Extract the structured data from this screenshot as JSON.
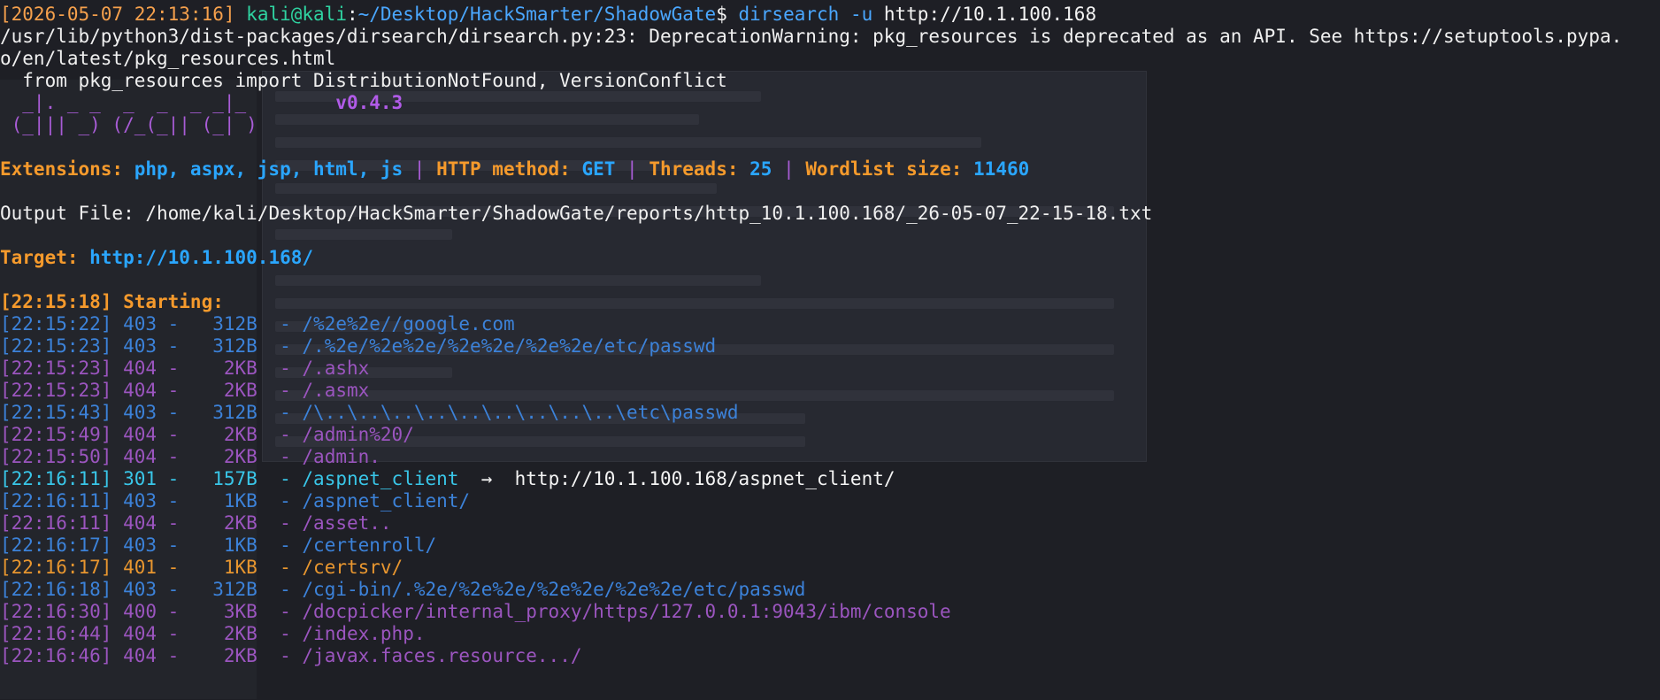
{
  "window": {
    "title": "kali@kali: ~/Desktop/HackSmarter/ShadowGate"
  },
  "prompt": {
    "time": "[2026-05-07 22:13:16]",
    "user_host": "kali@kali",
    "sep": ":",
    "path": "~/Desktop/HackSmarter/ShadowGate",
    "dollar": "$ ",
    "exe": "dirsearch",
    "flag": " -u",
    "arg": " http://10.1.100.168"
  },
  "warning": {
    "line1": "/usr/lib/python3/dist-packages/dirsearch/dirsearch.py:23: DeprecationWarning: pkg_resources is deprecated as an API. See https://setuptools.pypa.",
    "line2": "o/en/latest/pkg_resources.html",
    "line3": "  from pkg_resources import DistributionNotFound, VersionConflict"
  },
  "banner": {
    "top": "  _|. _ _  _  _  _ _|_",
    "bottom": " (_||| _) (/_(_|| (_| )",
    "version": "v0.4.3"
  },
  "config": {
    "ext_label": "Extensions: ",
    "ext_value": "php, aspx, jsp, html, js",
    "sep": " | ",
    "method_label": "HTTP method: ",
    "method_value": "GET",
    "threads_label": "Threads: ",
    "threads_value": "25",
    "wordlist_label": "Wordlist size: ",
    "wordlist_value": "11460"
  },
  "output": {
    "label": "Output File: ",
    "path": "/home/kali/Desktop/HackSmarter/ShadowGate/reports/http_10.1.100.168/_26-05-07_22-15-18.txt"
  },
  "target": {
    "label": "Target: ",
    "url": "http://10.1.100.168/"
  },
  "starting": "[22:15:18] Starting: ",
  "results": [
    {
      "time": "[22:15:22]",
      "code": "403",
      "size": "  312B",
      "path": "/%2e%2e//google.com",
      "redirect": ""
    },
    {
      "time": "[22:15:23]",
      "code": "403",
      "size": "  312B",
      "path": "/.%2e/%2e%2e/%2e%2e/%2e%2e/etc/passwd",
      "redirect": ""
    },
    {
      "time": "[22:15:23]",
      "code": "404",
      "size": "   2KB",
      "path": "/.ashx",
      "redirect": ""
    },
    {
      "time": "[22:15:23]",
      "code": "404",
      "size": "   2KB",
      "path": "/.asmx",
      "redirect": ""
    },
    {
      "time": "[22:15:43]",
      "code": "403",
      "size": "  312B",
      "path": "/\\..\\..\\..\\..\\..\\..\\..\\..\\..\\etc\\passwd",
      "redirect": ""
    },
    {
      "time": "[22:15:49]",
      "code": "404",
      "size": "   2KB",
      "path": "/admin%20/",
      "redirect": ""
    },
    {
      "time": "[22:15:50]",
      "code": "404",
      "size": "   2KB",
      "path": "/admin.",
      "redirect": ""
    },
    {
      "time": "[22:16:11]",
      "code": "301",
      "size": "  157B",
      "path": "/aspnet_client",
      "redirect": "  →  http://10.1.100.168/aspnet_client/"
    },
    {
      "time": "[22:16:11]",
      "code": "403",
      "size": "   1KB",
      "path": "/aspnet_client/",
      "redirect": ""
    },
    {
      "time": "[22:16:11]",
      "code": "404",
      "size": "   2KB",
      "path": "/asset..",
      "redirect": ""
    },
    {
      "time": "[22:16:17]",
      "code": "403",
      "size": "   1KB",
      "path": "/certenroll/",
      "redirect": ""
    },
    {
      "time": "[22:16:17]",
      "code": "401",
      "size": "   1KB",
      "path": "/certsrv/",
      "redirect": ""
    },
    {
      "time": "[22:16:18]",
      "code": "403",
      "size": "  312B",
      "path": "/cgi-bin/.%2e/%2e%2e/%2e%2e/%2e%2e/etc/passwd",
      "redirect": ""
    },
    {
      "time": "[22:16:30]",
      "code": "400",
      "size": "   3KB",
      "path": "/docpicker/internal_proxy/https/127.0.0.1:9043/ibm/console",
      "redirect": ""
    },
    {
      "time": "[22:16:44]",
      "code": "404",
      "size": "   2KB",
      "path": "/index.php.",
      "redirect": ""
    },
    {
      "time": "[22:16:46]",
      "code": "404",
      "size": "   2KB",
      "path": "/javax.faces.resource.../",
      "redirect": ""
    }
  ]
}
